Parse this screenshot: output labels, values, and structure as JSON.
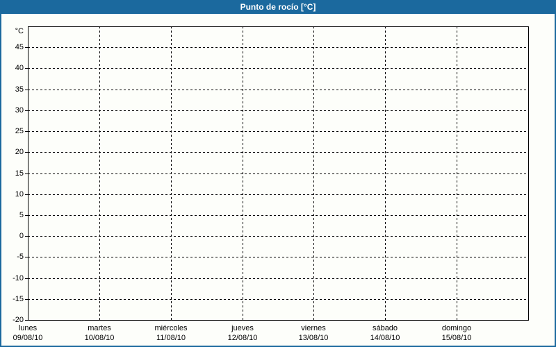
{
  "window": {
    "title": "Punto de rocío [°C]"
  },
  "colors": {
    "frame": "#1B699E",
    "title_text": "#FFFFFF",
    "background": "#FDFEFA",
    "grid": "#000000"
  },
  "chart_data": {
    "type": "line",
    "title": "Punto de rocío [°C]",
    "ylabel": "°C",
    "ylim": [
      -20,
      50
    ],
    "ytick_step": 5,
    "yticks": [
      45,
      40,
      35,
      30,
      25,
      20,
      15,
      10,
      5,
      0,
      -5,
      -10,
      -15,
      -20
    ],
    "grid": true,
    "legend": "none",
    "x_categories": [
      {
        "day": "lunes",
        "date": "09/08/10"
      },
      {
        "day": "martes",
        "date": "10/08/10"
      },
      {
        "day": "miércoles",
        "date": "11/08/10"
      },
      {
        "day": "jueves",
        "date": "12/08/10"
      },
      {
        "day": "viernes",
        "date": "13/08/10"
      },
      {
        "day": "sábado",
        "date": "14/08/10"
      },
      {
        "day": "domingo",
        "date": "15/08/10"
      }
    ],
    "series": []
  }
}
